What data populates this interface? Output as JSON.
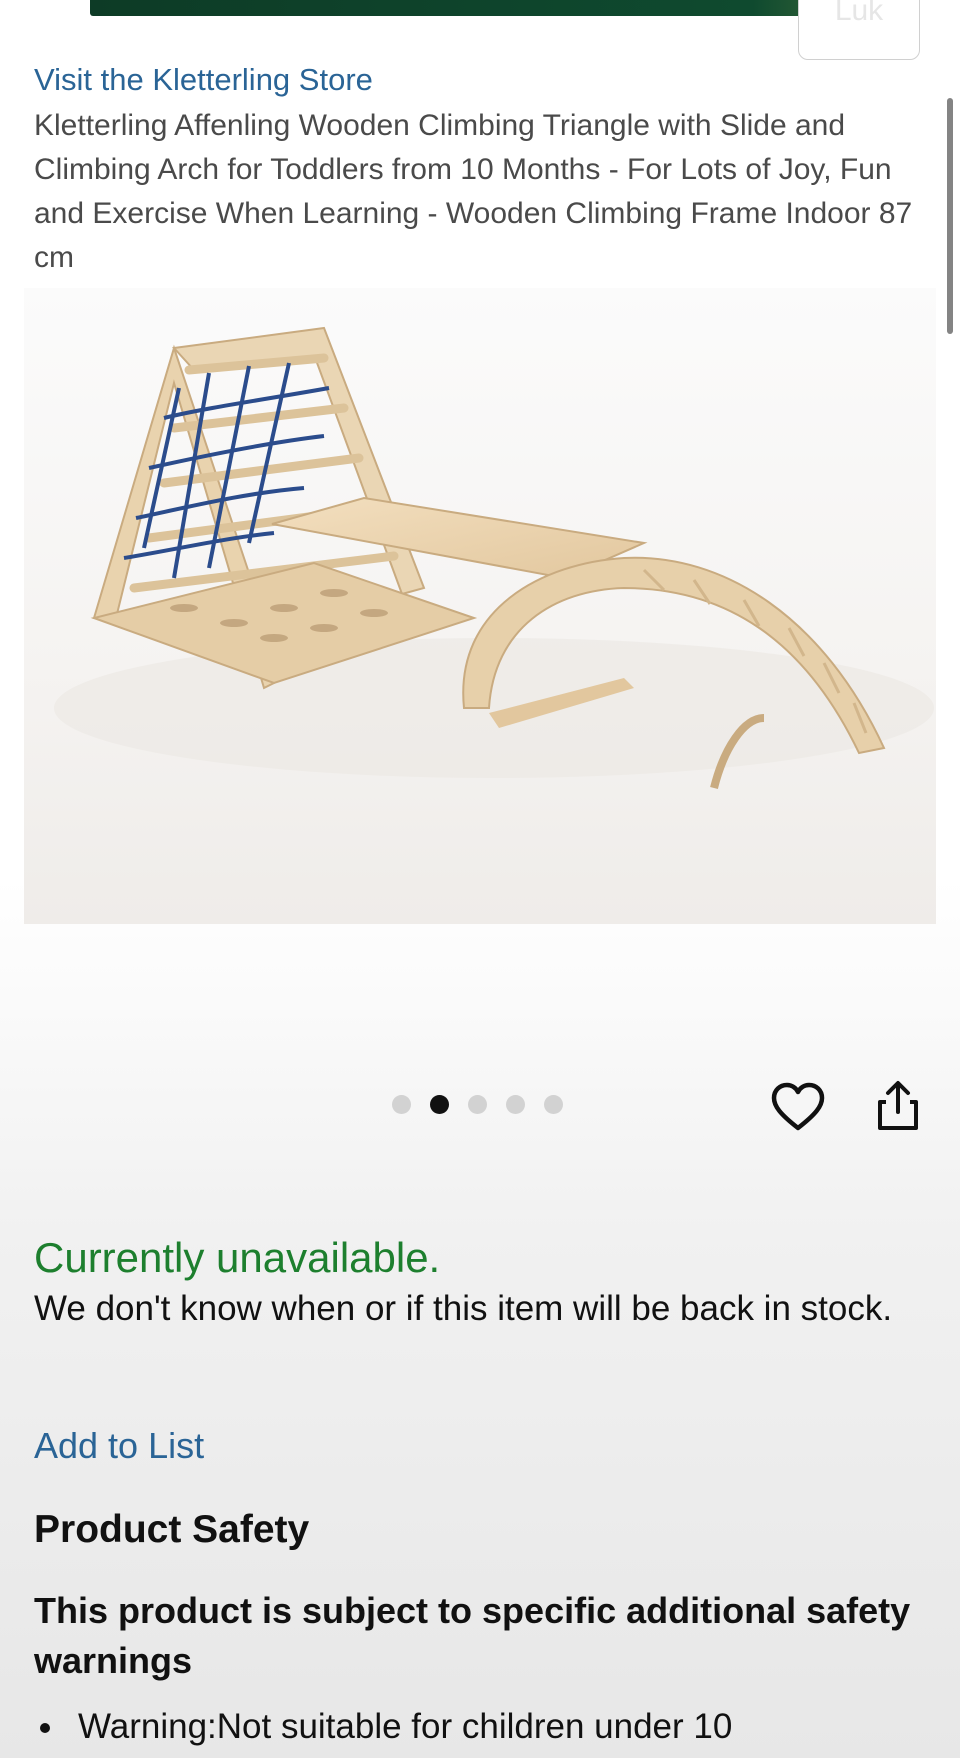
{
  "header": {
    "account_label": "Luk"
  },
  "product": {
    "store_link": "Visit the Kletterling Store",
    "title": "Kletterling Affenling Wooden Climbing Triangle with Slide and Climbing Arch for Toddlers from 10 Months - For Lots of Joy, Fun and Exercise When Learning - Wooden Climbing Frame Indoor 87 cm",
    "image": {
      "icon": "wooden-climbing-set-image"
    },
    "carousel": {
      "total": 5,
      "active_index": 1
    },
    "actions": {
      "wishlist_icon": "heart-icon",
      "share_icon": "share-icon"
    }
  },
  "availability": {
    "status": "Currently unavailable.",
    "status_color": "#1d7f2e",
    "note": "We don't know when or if this item will be back in stock."
  },
  "add_to_list": "Add to List",
  "safety": {
    "heading": "Product Safety",
    "subheading": "This product is subject to specific additional safety warnings",
    "warnings": [
      "Warning:Not suitable for children under 10"
    ]
  },
  "colors": {
    "link": "#2a6496",
    "banner": "#0f4a2f"
  }
}
